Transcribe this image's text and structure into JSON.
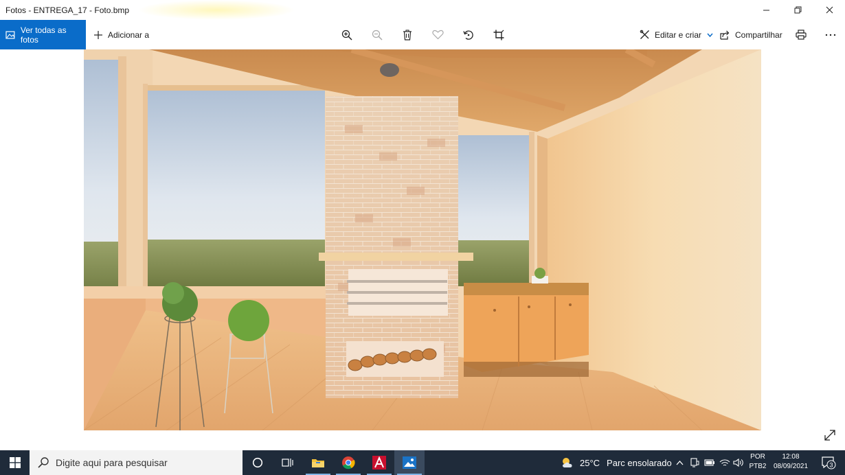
{
  "window": {
    "title": "Fotos - ENTREGA_17 - Foto.bmp",
    "controls": [
      "minimize-icon",
      "restore-icon",
      "close-icon"
    ]
  },
  "toolbar": {
    "see_all_label": "Ver todas as fotos",
    "add_to_label": "Adicionar a",
    "edit_create_label": "Editar e criar",
    "share_label": "Compartilhar",
    "icons": [
      "zoom-in-icon",
      "zoom-out-icon",
      "delete-icon",
      "favorite-icon",
      "rotate-icon",
      "crop-icon",
      "print-icon",
      "more-icon"
    ]
  },
  "colors": {
    "accent": "#0a6cc9",
    "taskbar": "#1f2b3a",
    "search_bg": "#f3f3f3"
  },
  "taskbar": {
    "search_placeholder": "Digite aqui para pesquisar",
    "apps": [
      "cortana-icon",
      "task-view-icon",
      "file-explorer-icon",
      "chrome-icon",
      "autocad-icon",
      "photos-icon"
    ],
    "weather": {
      "temp": "25°C",
      "condition": "Parc ensolarado"
    },
    "language": {
      "line1": "POR",
      "line2": "PTB2"
    },
    "clock": {
      "time": "12:08",
      "date": "08/09/2021"
    },
    "notifications_count": "3"
  }
}
